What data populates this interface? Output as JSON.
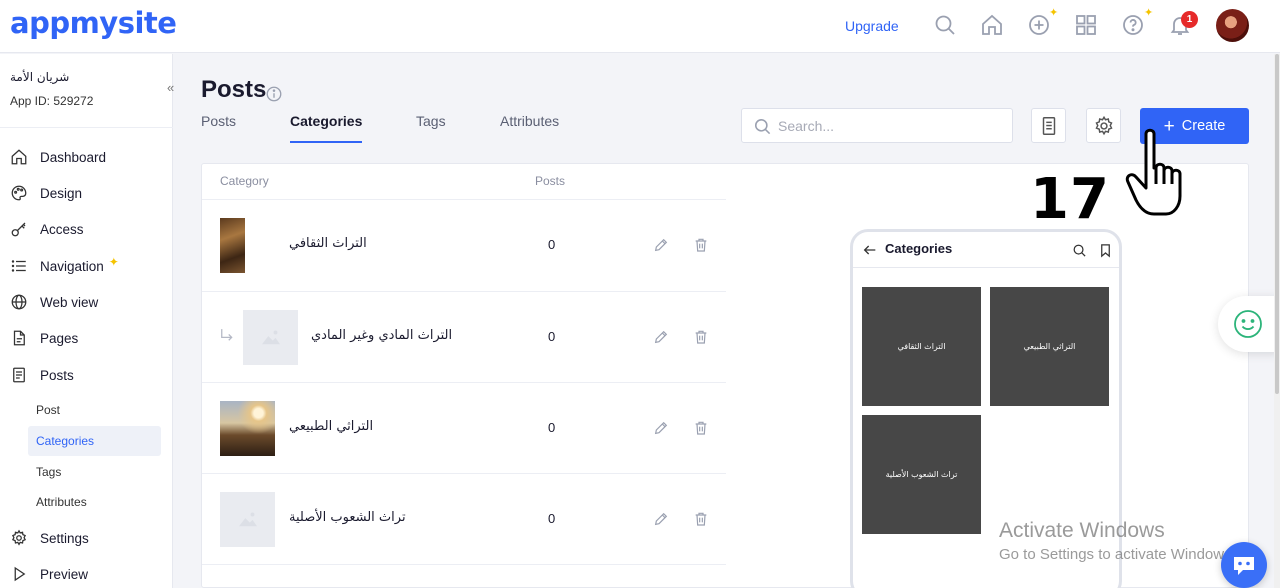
{
  "brand": {
    "logo": "appmysite",
    "accent": "#3064f6"
  },
  "topbar": {
    "upgrade": "Upgrade",
    "icons": [
      "search-icon",
      "home-icon",
      "add-circle-icon",
      "apps-grid-icon",
      "help-icon",
      "bell-icon"
    ],
    "notification_count": "1"
  },
  "sidebar": {
    "app_name": "شريان الأمة",
    "app_id": "App ID: 529272",
    "items": [
      {
        "label": "Dashboard",
        "icon": "home-icon"
      },
      {
        "label": "Design",
        "icon": "palette-icon"
      },
      {
        "label": "Access",
        "icon": "key-icon"
      },
      {
        "label": "Navigation",
        "icon": "list-icon"
      },
      {
        "label": "Web view",
        "icon": "globe-icon"
      },
      {
        "label": "Pages",
        "icon": "page-icon"
      },
      {
        "label": "Posts",
        "icon": "posts-icon"
      }
    ],
    "sub_items": [
      "Post",
      "Categories",
      "Tags",
      "Attributes"
    ],
    "bottom_items": [
      {
        "label": "Settings",
        "icon": "gear-icon"
      },
      {
        "label": "Preview",
        "icon": "play-icon"
      }
    ]
  },
  "page": {
    "title": "Posts",
    "tabs": [
      "Posts",
      "Categories",
      "Tags",
      "Attributes"
    ],
    "active_tab": "Categories",
    "search_placeholder": "Search...",
    "create_label": "Create"
  },
  "table": {
    "columns": [
      "Category",
      "Posts"
    ],
    "rows": [
      {
        "name": "التراث الثقافي",
        "posts": "0",
        "child": false,
        "image": "building-photo"
      },
      {
        "name": "التراث المادي وغير المادي",
        "posts": "0",
        "child": true,
        "image": "placeholder"
      },
      {
        "name": "التراثي الطبيعي",
        "posts": "0",
        "child": false,
        "image": "desert-photo"
      },
      {
        "name": "تراث الشعوب الأصلية",
        "posts": "0",
        "child": false,
        "image": "placeholder"
      }
    ]
  },
  "preview": {
    "title": "Categories",
    "tiles": [
      "التراث الثقافي",
      "التراثي الطبيعي",
      "تراث الشعوب الأصلية"
    ]
  },
  "overlay": {
    "count": "17"
  },
  "watermark": {
    "line1": "Activate Windows",
    "line2": "Go to Settings to activate Windows."
  }
}
